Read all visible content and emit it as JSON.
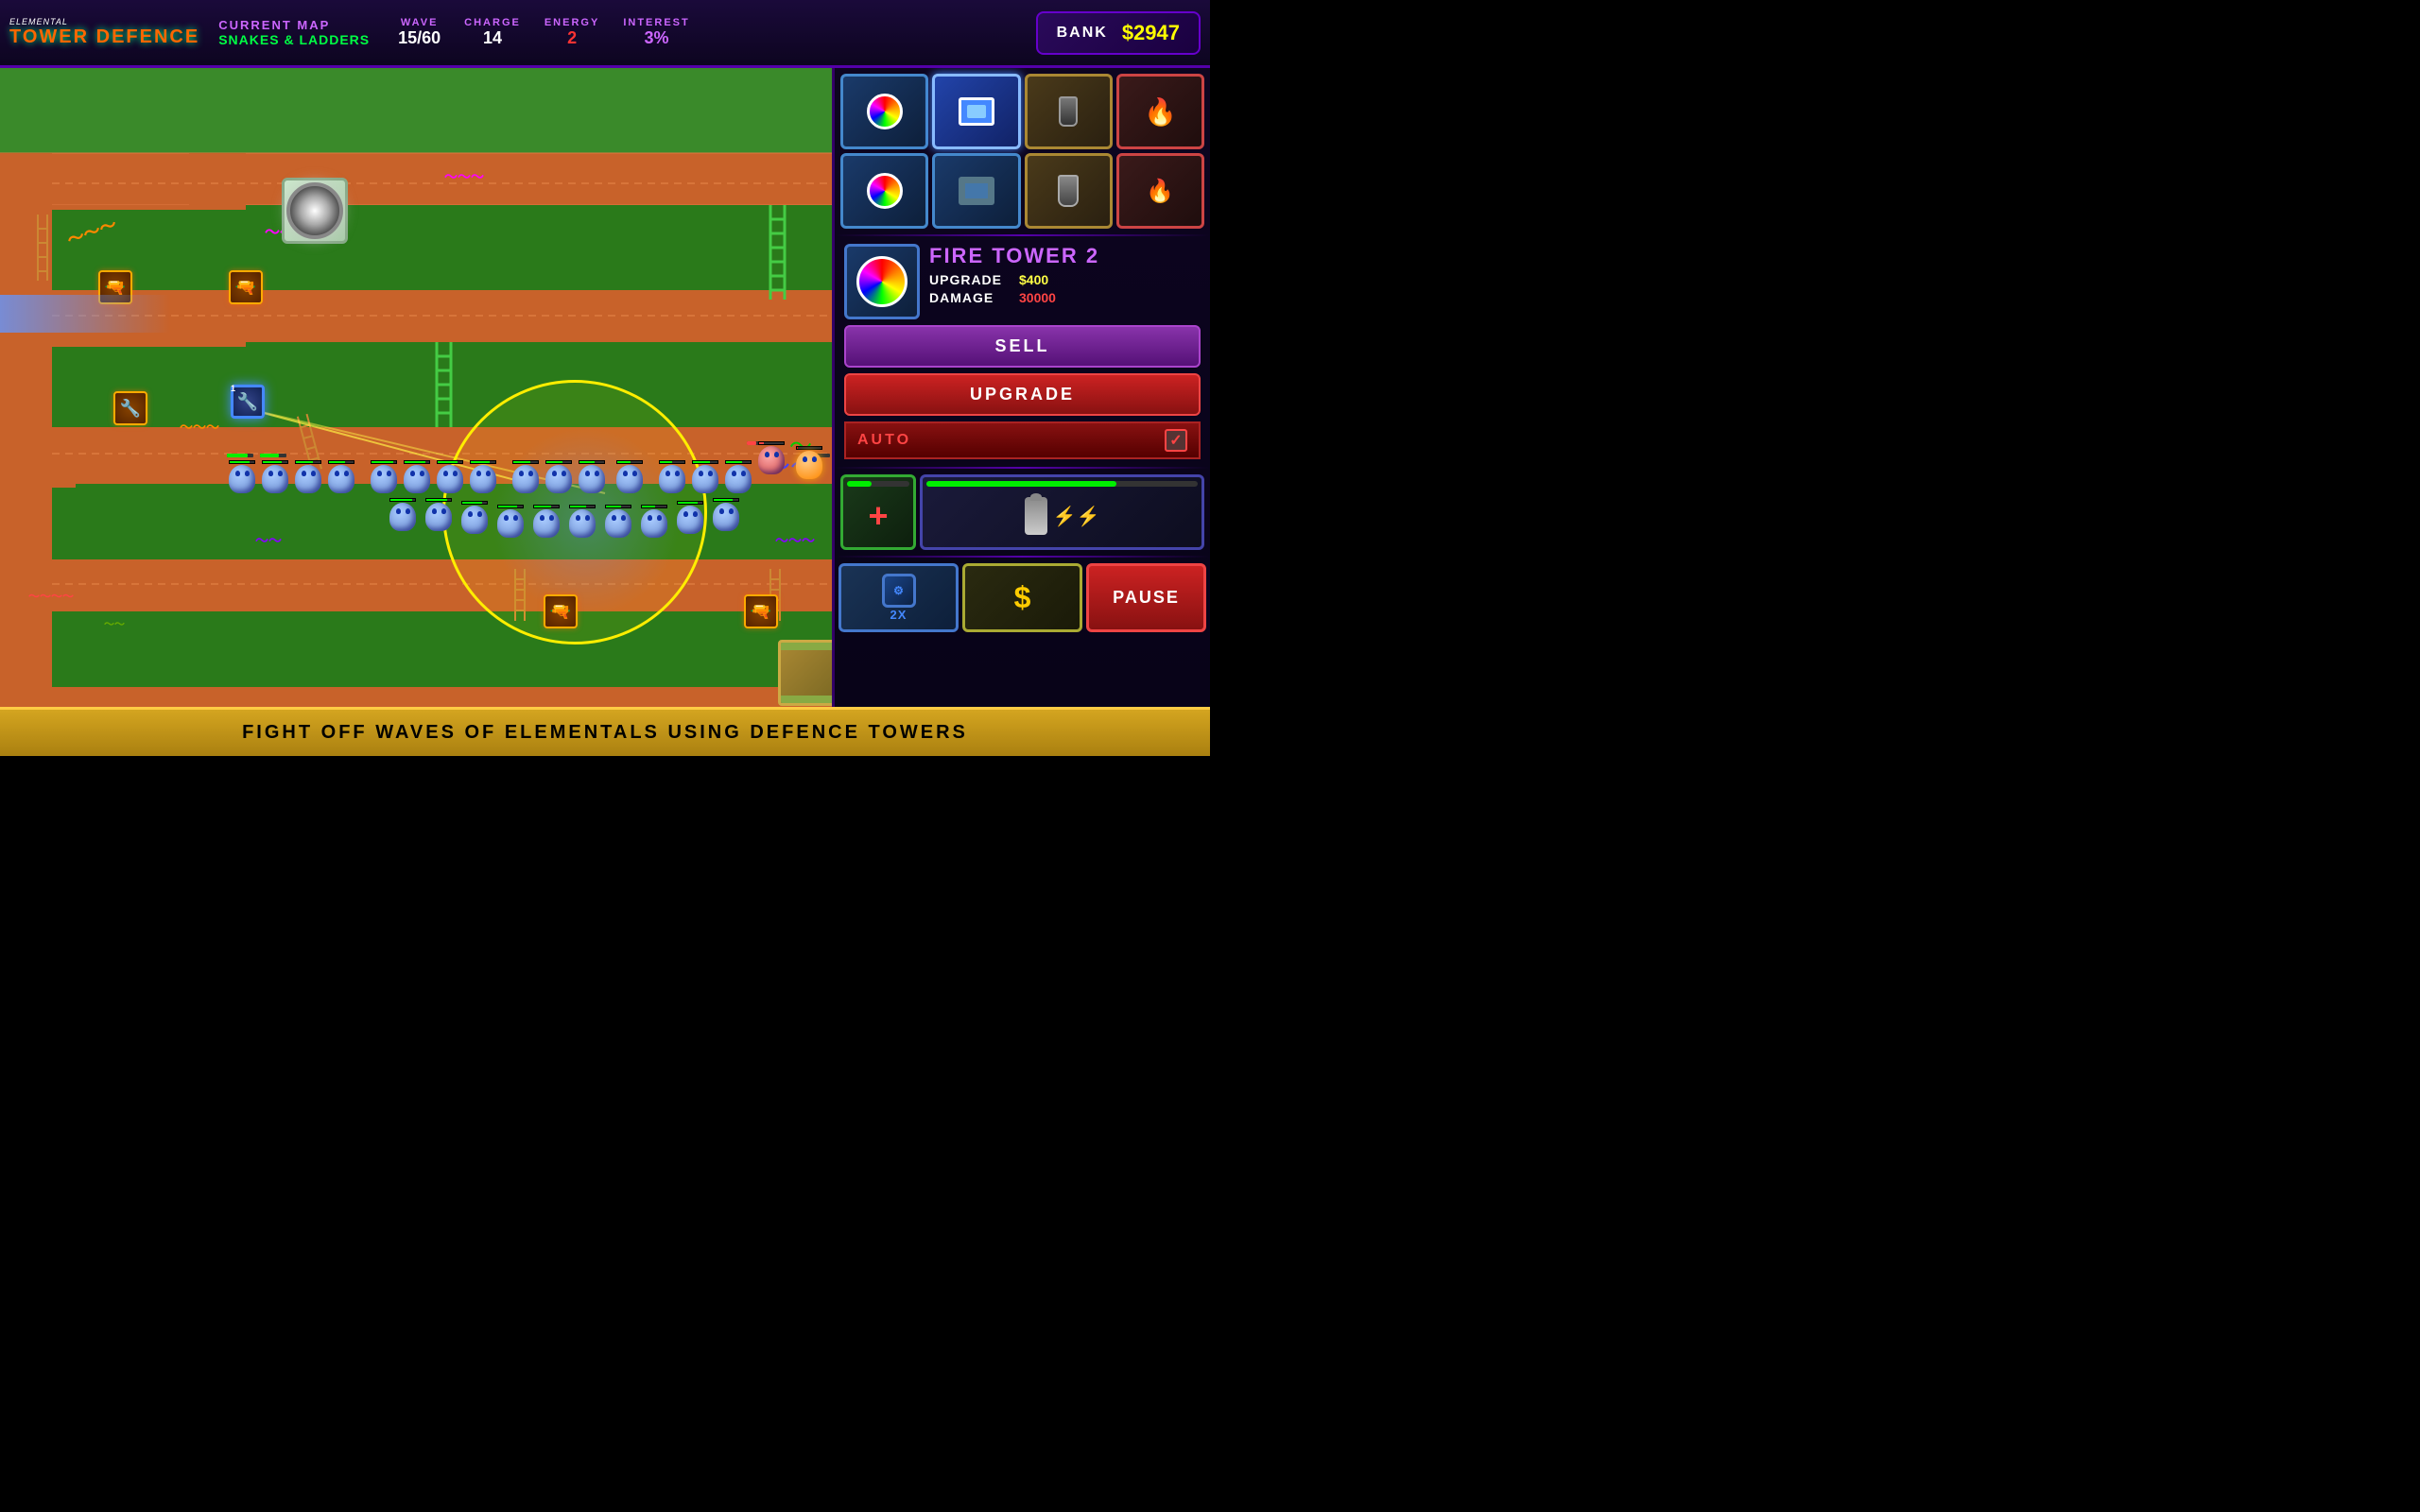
{
  "header": {
    "logo_top": "ELEMENTAL",
    "logo_main1": "TOWER",
    "logo_main2": "DEFENCE",
    "map_label": "CURRENT MAP",
    "map_name": "SNAKES & LADDERS",
    "wave_label": "WAVE",
    "wave_value": "15/60",
    "charge_label": "CHARGE",
    "charge_value": "14",
    "energy_label": "ENERGY",
    "energy_value": "2",
    "interest_label": "INTEREST",
    "interest_value": "3%",
    "bank_label": "BANK",
    "bank_amount": "$2947"
  },
  "selected_tower": {
    "name": "FIRE TOWER 2",
    "upgrade_label": "UPGRADE",
    "upgrade_cost": "$400",
    "damage_label": "DAMAGE",
    "damage_value": "30000",
    "sell_label": "SELL",
    "upgrade_btn_label": "UPGRADE",
    "auto_label": "AUTO",
    "auto_checked": true
  },
  "tower_grid_row1": [
    {
      "id": "t1",
      "type": "spiral",
      "selected": false,
      "tier": "tier1"
    },
    {
      "id": "t2",
      "type": "screen",
      "selected": true,
      "tier": "tier1"
    },
    {
      "id": "t3",
      "type": "cannon",
      "selected": false,
      "tier": "tier2"
    },
    {
      "id": "t4",
      "type": "electric",
      "selected": false,
      "tier": "tier3"
    }
  ],
  "tower_grid_row2": [
    {
      "id": "t5",
      "type": "spiral",
      "selected": false,
      "tier": "tier1"
    },
    {
      "id": "t6",
      "type": "screen",
      "selected": false,
      "tier": "tier1"
    },
    {
      "id": "t7",
      "type": "cannon2",
      "selected": false,
      "tier": "tier2"
    },
    {
      "id": "t8",
      "type": "electric2",
      "selected": false,
      "tier": "tier3"
    }
  ],
  "special_towers": {
    "health_label": "+",
    "lightning_label": "⚡"
  },
  "bottom_controls": {
    "speed_label": "2X",
    "money_label": "$",
    "pause_label": "PAUSE"
  },
  "message_bar": {
    "text": "FIGHT OFF WAVES OF ELEMENTALS USING DEFENCE TOWERS"
  }
}
